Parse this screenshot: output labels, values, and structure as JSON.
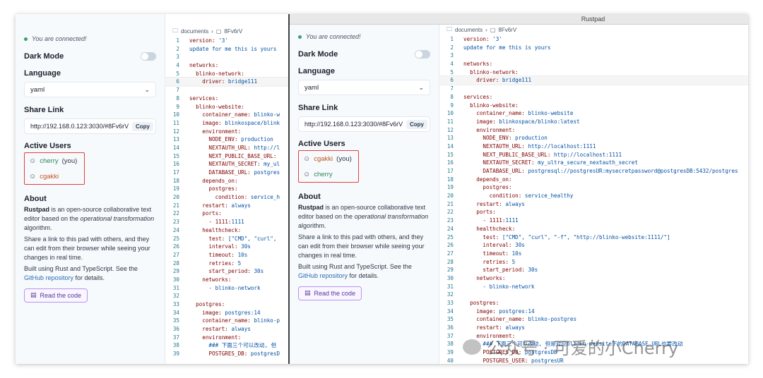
{
  "left": {
    "connected": "You are connected!",
    "dark_mode": "Dark Mode",
    "language": "Language",
    "language_value": "yaml",
    "share_link": "Share Link",
    "share_url": "http://192.168.0.123:3030/#8Fv6rV",
    "copy": "Copy",
    "active_users": "Active Users",
    "users": [
      {
        "name": "cherry",
        "suffix": "(you)",
        "color": "#2f855a"
      },
      {
        "name": "cgakki",
        "suffix": "",
        "color": "#c05621"
      }
    ],
    "about": "About",
    "about_p1_bold": "Rustpad",
    "about_p1_a": " is an open-source collaborative text editor based on the ",
    "about_p1_italic": "operational transformation",
    "about_p1_b": " algorithm.",
    "about_p2": "Share a link to this pad with others, and they can edit from their browser while seeing your changes in real time.",
    "about_p3_a": "Built using Rust and TypeScript. See the ",
    "about_p3_link": "GitHub repository",
    "about_p3_b": " for details.",
    "read_code": "Read the code",
    "crumb_folder": "documents",
    "crumb_file": "8Fv6rV"
  },
  "right": {
    "title": "Rustpad",
    "connected": "You are connected!",
    "dark_mode": "Dark Mode",
    "language": "Language",
    "language_value": "yaml",
    "share_link": "Share Link",
    "share_url": "http://192.168.0.123:3030/#8Fv6rV",
    "copy": "Copy",
    "active_users": "Active Users",
    "users": [
      {
        "name": "cgakki",
        "suffix": "(you)",
        "color": "#c05621"
      },
      {
        "name": "cherry",
        "suffix": "",
        "color": "#2f855a"
      }
    ],
    "about": "About",
    "about_p1_bold": "Rustpad",
    "about_p1_a": " is an open-source collaborative text editor based on the ",
    "about_p1_italic": "operational transformation",
    "about_p1_b": " algorithm.",
    "about_p2": "Share a link to this pad with others, and they can edit from their browser while seeing your changes in real time.",
    "about_p3_a": "Built using Rust and TypeScript. See the ",
    "about_p3_link": "GitHub repository",
    "about_p3_b": " for details.",
    "read_code": "Read the code",
    "crumb_folder": "documents",
    "crumb_file": "8Fv6rV"
  },
  "code_left": [
    "version: '3'",
    "update for me this is yours",
    "",
    "networks:",
    "  blinko-network:",
    "    driver: bridge111",
    "",
    "services:",
    "  blinko-website:",
    "    container_name: blinko-w",
    "    image: blinkospace/blink",
    "    environment:",
    "      NODE_ENV: production",
    "      NEXTAUTH_URL: http://l",
    "      NEXT_PUBLIC_BASE_URL:",
    "      NEXTAUTH_SECRET: my_ul",
    "      DATABASE_URL: postgres",
    "    depends_on:",
    "      postgres:",
    "        condition: service_h",
    "    restart: always",
    "    ports:",
    "      - 1111:1111",
    "    healthcheck:",
    "      test: [\"CMD\", \"curl\",",
    "      interval: 30s",
    "      timeout: 10s",
    "      retries: 5",
    "      start_period: 30s",
    "    networks:",
    "      - blinko-network",
    "",
    "  postgres:",
    "    image: postgres:14",
    "    container_name: blinko-p",
    "    restart: always",
    "    environment:",
    "      ### 下面三个可以改动, 但",
    "      POSTGRES_DB: postgresD"
  ],
  "code_right": [
    "version: '3'",
    "update for me this is yours",
    "",
    "networks:",
    "  blinko-network:",
    "    driver: bridge111",
    "",
    "services:",
    "  blinko-website:",
    "    container_name: blinko-website",
    "    image: blinkospace/blinko:latest",
    "    environment:",
    "      NODE_ENV: production",
    "      NEXTAUTH_URL: http://localhost:1111",
    "      NEXT_PUBLIC_BASE_URL: http://localhost:1111",
    "      NEXTAUTH_SECRET: my_ultra_secure_nextauth_secret",
    "      DATABASE_URL: postgresql://postgresUR:mysecretpassword@postgresDB:5432/postgres",
    "    depends_on:",
    "      postgres:",
    "        condition: service_healthy",
    "    restart: always",
    "    ports:",
    "      - 1111:1111",
    "    healthcheck:",
    "      test: [\"CMD\", \"curl\", \"-f\", \"http://blinko-website:1111/\"]",
    "      interval: 30s",
    "      timeout: 10s",
    "      retries: 5",
    "      start_period: 30s",
    "    networks:",
    "      - blinko-network",
    "",
    "  postgres:",
    "    image: postgres:14",
    "    container_name: blinko-postgres",
    "    restart: always",
    "    environment:",
    "      ### 下面三个可以改动, 但是对应blinko-website下的DATABASE_URL也要改动",
    "      POSTGRES_DB: postgresDB",
    "      POSTGRES_USER: postgresUR"
  ],
  "watermark": "公众号 · 可爱的小Cherry",
  "colors": {
    "accent": "#2b6cb0",
    "highlight_border": "#e53e3e",
    "line_number": "#237893",
    "yaml_key": "#800000",
    "yaml_value": "#0451a5"
  }
}
